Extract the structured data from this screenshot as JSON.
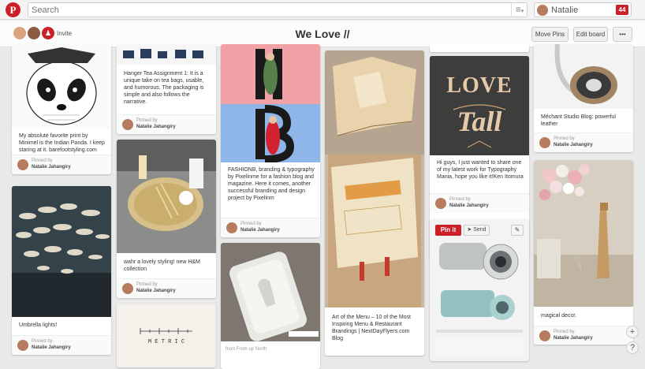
{
  "topbar": {
    "search_placeholder": "Search",
    "user_name": "Natalie",
    "notification_count": "44"
  },
  "board": {
    "invite_label": "Invite",
    "title": "We Love //",
    "move_pins_label": "Move Pins",
    "edit_board_label": "Edit board",
    "more_label": "•••"
  },
  "pinned_by_label": "Pinned by",
  "pinner_name": "Natalie Jahangiry",
  "pins": {
    "panda": {
      "desc": "My absolute favorite print by Minimel is the Indian Panda. I keep staring at it. barefootstyling.com"
    },
    "umbrella": {
      "desc": "Umbrella lights!"
    },
    "tea": {
      "desc": "Hanger Tea Assignment 1: It is a unique take on tea bags, usable, and humorous. The packaging is simple and also follows the narrative."
    },
    "gold": {
      "desc": "wahr a lovely styling! new H&M collection"
    },
    "metric": {
      "word": "M E T R I C"
    },
    "fashion": {
      "desc": "FASHIONB, branding & typography by Pixelinme for a fashion blog and magazine. Here it comes, another successful branding and design project by Pixelinm"
    },
    "card_note": {
      "from": "from From up North"
    },
    "menu": {
      "desc": "Art of the Menu – 10 of the Most Inspiring Menu & Restaurant Brandings | NextDayFlyers.com Blog"
    },
    "love": {
      "desc": "Hi guys, I just wanted to share one of my latest work for Typography Mania, hope you like it!Ken Itomura",
      "word1": "LOVE",
      "word2": "Tall"
    },
    "camera": {
      "pinit_label": "Pin it",
      "send_label": "Send"
    },
    "headphones": {
      "desc": "Méchant Studio Blog: powerful leather"
    },
    "balloon": {
      "desc": "magical decor."
    }
  },
  "fab": {
    "add": "+",
    "help": "?"
  }
}
